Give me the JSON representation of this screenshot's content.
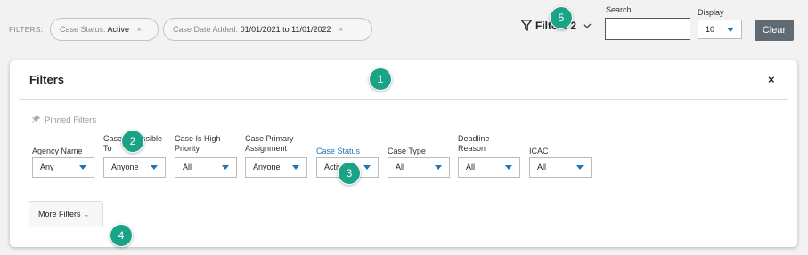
{
  "topbar": {
    "filters_label": "FILTERS:",
    "chips": [
      {
        "key": "Case Status:",
        "value": "Active",
        "remove": "×"
      },
      {
        "key": "Case Date Added:",
        "value": "01/01/2021 to 11/01/2022",
        "remove": "×"
      }
    ],
    "filter_toggle": {
      "label": "Filters",
      "count": "2",
      "icon": "funnel-icon"
    },
    "search": {
      "label": "Search",
      "value": ""
    },
    "display": {
      "label": "Display",
      "value": "10"
    },
    "clear_label": "Clear"
  },
  "panel": {
    "title": "Filters",
    "close": "×",
    "pinned_label": "Pinned Filters",
    "filters": [
      {
        "label": "Agency Name",
        "value": "Any"
      },
      {
        "label": "Case Accessible To",
        "value": "Anyone"
      },
      {
        "label": "Case Is High Priority",
        "value": "All"
      },
      {
        "label": "Case Primary Assignment",
        "value": "Anyone"
      },
      {
        "label": "Case Status",
        "value": "Active"
      },
      {
        "label": "Case Type",
        "value": "All"
      },
      {
        "label": "Deadline Reason",
        "value": "All"
      },
      {
        "label": "ICAC",
        "value": "All"
      }
    ],
    "more_filters_label": "More Filters"
  },
  "callouts": [
    "1",
    "2",
    "3",
    "4",
    "5"
  ],
  "colors": {
    "accent": "#1e75b8",
    "callout": "#1aa386",
    "clear_button": "#5f6a72"
  }
}
